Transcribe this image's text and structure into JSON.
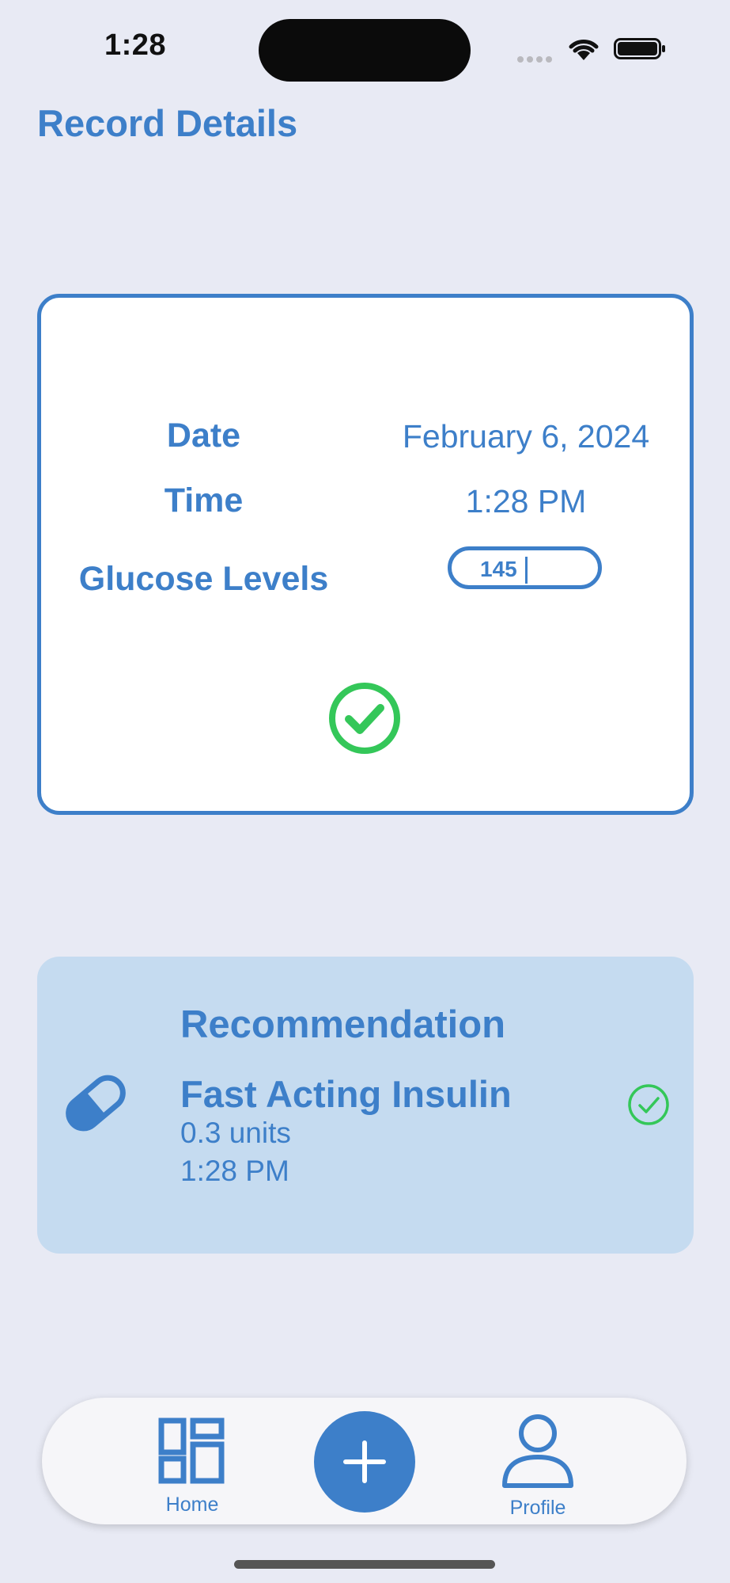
{
  "status_bar": {
    "time": "1:28"
  },
  "header": {
    "title": "Record Details"
  },
  "record": {
    "date_label": "Date",
    "date_value": "February 6, 2024",
    "time_label": "Time",
    "time_value": "1:28 PM",
    "glucose_label": "Glucose Levels",
    "glucose_value": "145"
  },
  "recommendation": {
    "title": "Recommendation",
    "medication": "Fast Acting Insulin",
    "dose": "0.3 units",
    "time": "1:28 PM"
  },
  "tab_bar": {
    "home_label": "Home",
    "profile_label": "Profile"
  },
  "colors": {
    "accent": "#3d7fc9",
    "success": "#34c759",
    "background": "#e8eaf4",
    "recommendation_bg": "#c5dbf0"
  }
}
